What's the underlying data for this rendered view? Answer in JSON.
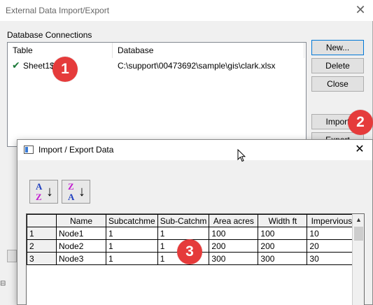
{
  "outer": {
    "title": "External Data Import/Export",
    "close_glyph": "✕",
    "section_label": "Database Connections",
    "columns": [
      "Table",
      "Database"
    ],
    "rows": [
      {
        "table": "Sheet1$",
        "database": "C:\\support\\00473692\\sample\\gis\\clark.xlsx",
        "check": "✔"
      }
    ],
    "buttons": {
      "new": "New...",
      "delete": "Delete",
      "close": "Close",
      "import": "Import",
      "export": "Export"
    }
  },
  "badges": [
    "1",
    "2",
    "3"
  ],
  "inner": {
    "title": "Import / Export Data",
    "close_glyph": "✕",
    "sort_az": {
      "top": "A",
      "bottom": "Z",
      "arrow": "↓"
    },
    "sort_za": {
      "top": "Z",
      "bottom": "A",
      "arrow": "↓"
    },
    "grid": {
      "headers": [
        "",
        "Name",
        "Subcatchme",
        "Sub-Catchm",
        "Area acres",
        "Width ft",
        "Impervious"
      ],
      "rows": [
        [
          "1",
          "Node1",
          "1",
          "1",
          "100",
          "100",
          "10"
        ],
        [
          "2",
          "Node2",
          "1",
          "1",
          "200",
          "200",
          "20"
        ],
        [
          "3",
          "Node3",
          "1",
          "1",
          "300",
          "300",
          "30"
        ]
      ]
    }
  },
  "colors": {
    "badge": "#e53b3b",
    "check": "#1d7a3a",
    "sort_a": "#1f3fbf",
    "sort_z": "#c21ccf"
  }
}
